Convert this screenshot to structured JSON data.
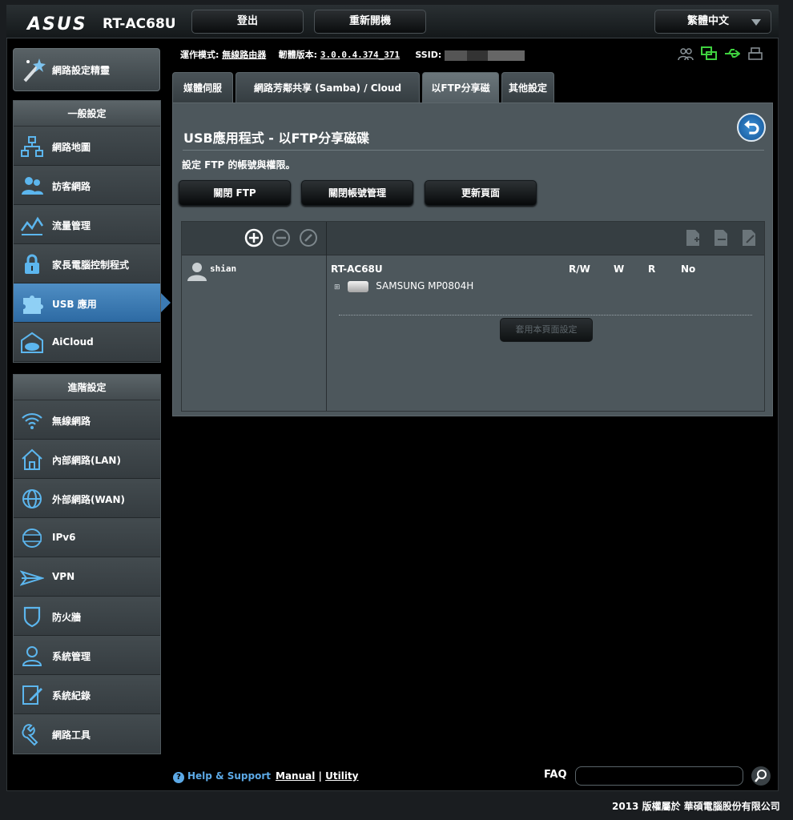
{
  "header": {
    "logo": "ASUS",
    "model": "RT-AC68U",
    "logout_label": "登出",
    "reboot_label": "重新開機",
    "language_label": "繁體中文"
  },
  "sidebar": {
    "wizard_label": "網路設定精靈",
    "general_title": "一般設定",
    "general_items": [
      {
        "label": "網路地圖",
        "icon": "network-map-icon"
      },
      {
        "label": "訪客網路",
        "icon": "guest-network-icon"
      },
      {
        "label": "流量管理",
        "icon": "traffic-manager-icon"
      },
      {
        "label": "家長電腦控制程式",
        "icon": "parental-control-icon"
      },
      {
        "label": "USB 應用",
        "icon": "usb-app-icon"
      },
      {
        "label": "AiCloud",
        "icon": "aicloud-icon"
      }
    ],
    "advanced_title": "進階設定",
    "advanced_items": [
      {
        "label": "無線網路",
        "icon": "wireless-icon"
      },
      {
        "label": "內部網路(LAN)",
        "icon": "lan-icon"
      },
      {
        "label": "外部網路(WAN)",
        "icon": "wan-icon"
      },
      {
        "label": "IPv6",
        "icon": "ipv6-icon"
      },
      {
        "label": "VPN",
        "icon": "vpn-icon"
      },
      {
        "label": "防火牆",
        "icon": "firewall-icon"
      },
      {
        "label": "系統管理",
        "icon": "administration-icon"
      },
      {
        "label": "系統紀錄",
        "icon": "system-log-icon"
      },
      {
        "label": "網路工具",
        "icon": "network-tools-icon"
      }
    ]
  },
  "info": {
    "mode_label": "運作模式:",
    "mode_value": "無線路由器",
    "firmware_label": "韌體版本:",
    "firmware_value": "3.0.0.4.374_371",
    "ssid_label": "SSID:"
  },
  "tabs": [
    {
      "label": "媒體伺服器"
    },
    {
      "label": "網路芳鄰共享 (Samba) / Cloud Disk"
    },
    {
      "label": "以FTP分享磁碟"
    },
    {
      "label": "其他設定"
    }
  ],
  "main": {
    "title": "USB應用程式 - 以FTP分享磁碟",
    "description": "設定 FTP 的帳號與權限。",
    "buttons": {
      "close_ftp": "關閉 FTP",
      "close_account": "關閉帳號管理",
      "refresh": "更新頁面"
    },
    "ftp": {
      "user": "shian",
      "router": "RT-AC68U",
      "permissions": [
        "R/W",
        "W",
        "R",
        "No"
      ],
      "disk": "SAMSUNG MP0804H",
      "expand_symbol": "⊞",
      "apply_label": "套用本頁面設定"
    }
  },
  "footer": {
    "help": "Help & Support",
    "manual": "Manual",
    "separator": "|",
    "utility": "Utility",
    "faq": "FAQ",
    "copyright": "2013 版權屬於 華碩電腦股份有限公司"
  }
}
